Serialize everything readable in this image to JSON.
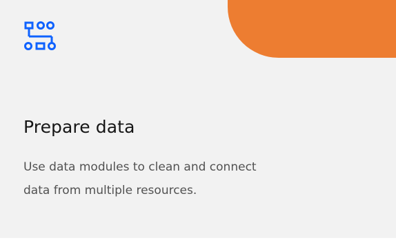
{
  "card": {
    "icon": "data-flow-icon",
    "title": "Prepare data",
    "description": "Use data modules to clean and connect data from multiple resources."
  },
  "colors": {
    "accent": "#ed7d31",
    "icon": "#0f62fe",
    "card_background": "#f2f2f2",
    "title": "#161616",
    "description": "#525252"
  }
}
